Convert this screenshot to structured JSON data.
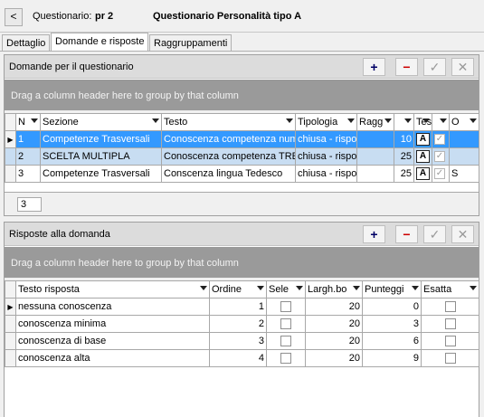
{
  "header": {
    "back": "<",
    "label": "Questionario:",
    "code": "pr 2",
    "title": "Questionario Personalità tipo A"
  },
  "tabs": [
    {
      "label": "Dettaglio"
    },
    {
      "label": "Domande e risposte"
    },
    {
      "label": "Raggruppamenti"
    }
  ],
  "toolbar": {
    "add": "+",
    "remove": "−",
    "confirm": "✓",
    "cancel": "✕"
  },
  "questions": {
    "title": "Domande per il questionario",
    "group_hint": "Drag a column header here to group by that column",
    "columns": [
      "N",
      "Sezione",
      "Testo",
      "Tipologia",
      "Ragg",
      "",
      "Tes",
      "",
      "O"
    ],
    "rows": [
      {
        "n": "1",
        "sezione": "Competenze Trasversali",
        "testo": "Conoscenza competenza numerica",
        "tipologia": "chiusa - risposta",
        "ragg": "",
        "val": "10",
        "o": ""
      },
      {
        "n": "2",
        "sezione": "SCELTA MULTIPLA",
        "testo": "Conoscenza competenza TRECCANI",
        "tipologia": "chiusa - risposta",
        "ragg": "",
        "val": "25",
        "o": ""
      },
      {
        "n": "3",
        "sezione": "Competenze Trasversali",
        "testo": "Conscenza lingua Tedesco",
        "tipologia": "chiusa - risposta",
        "ragg": "",
        "val": "25",
        "o": "S"
      }
    ],
    "count": "3"
  },
  "answers": {
    "title": "Risposte alla domanda",
    "group_hint": "Drag a column header here to group by that column",
    "columns": [
      "Testo risposta",
      "Ordine",
      "Sele",
      "Largh.bo",
      "Punteggi",
      "Esatta"
    ],
    "rows": [
      {
        "testo": "nessuna conoscenza",
        "ordine": "1",
        "largh": "20",
        "punteggio": "0"
      },
      {
        "testo": "conoscenza minima",
        "ordine": "2",
        "largh": "20",
        "punteggio": "3"
      },
      {
        "testo": "conoscenza di base",
        "ordine": "3",
        "largh": "20",
        "punteggio": "6"
      },
      {
        "testo": "conoscenza alta",
        "ordine": "4",
        "largh": "20",
        "punteggio": "9"
      }
    ]
  },
  "icons": {
    "current_row": "triangle-right",
    "row_doc": "A-document"
  },
  "colors": {
    "selection": "#3399ff",
    "alt_selection": "#c8ddf2",
    "group_panel": "#9a9a9a",
    "remove": "#cc0000",
    "add": "#000066"
  }
}
